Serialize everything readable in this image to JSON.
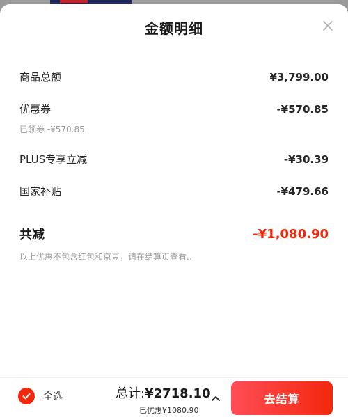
{
  "sheet": {
    "title": "金额明细"
  },
  "rows": {
    "goods_total": {
      "label": "商品总额",
      "value": "¥3,799.00"
    },
    "coupon": {
      "label": "优惠券",
      "value": "-¥570.85",
      "note": "已领券 -¥570.85"
    },
    "plus": {
      "label": "PLUS专享立减",
      "value": "-¥30.39"
    },
    "subsidy": {
      "label": "国家补贴",
      "value": "-¥479.66"
    }
  },
  "total_discount": {
    "label": "共减",
    "value": "-¥1,080.90"
  },
  "disclaimer": "以上优惠不包含红包和京豆，请在结算页查看..",
  "footer": {
    "select_all_label": "全选",
    "total_prefix": "总计:",
    "total_amount": "¥2718.10",
    "saved_text": "已优惠¥1080.90",
    "checkout_label": "去结算"
  },
  "icons": {
    "close": "close-icon",
    "check": "check-circle-icon",
    "chevron": "chevron-up-icon"
  },
  "colors": {
    "accent": "#f2270c",
    "checkout_gradient_start": "#ff4d57"
  }
}
